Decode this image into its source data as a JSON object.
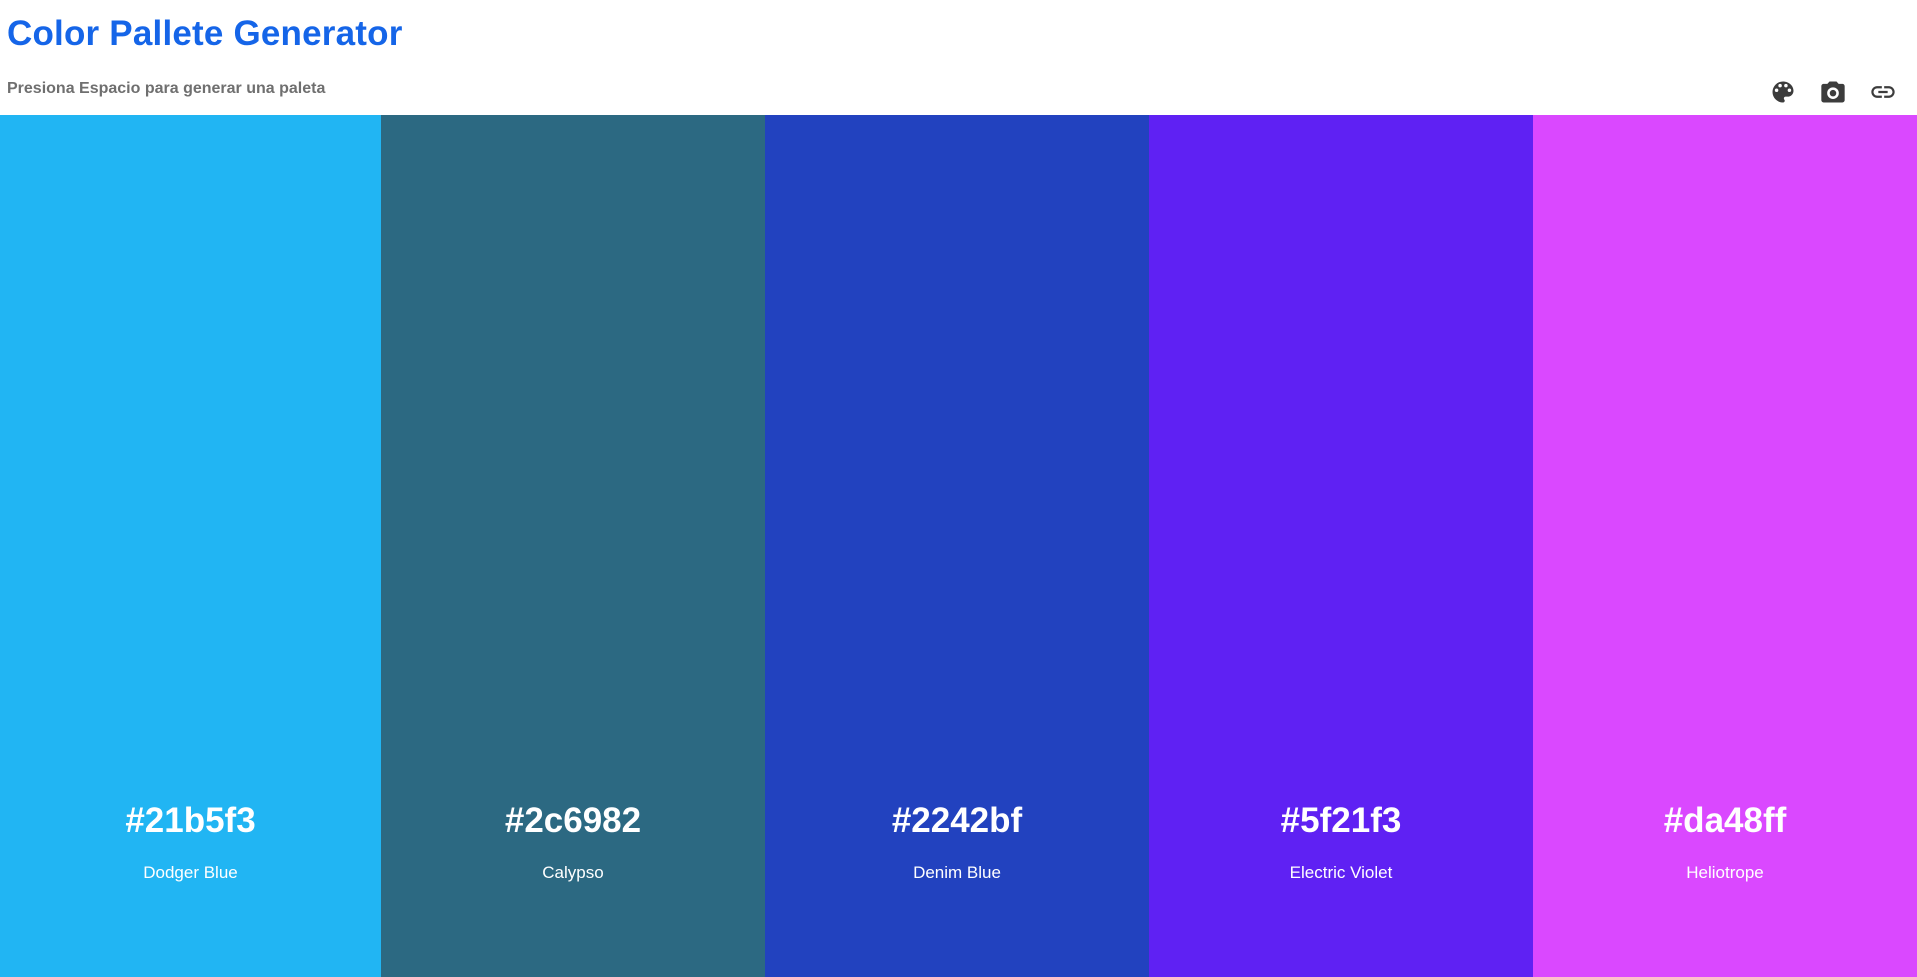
{
  "header": {
    "title": "Color Pallete Generator",
    "subtitle": "Presiona Espacio para generar una paleta"
  },
  "toolbar": {
    "icons": [
      "palette-icon",
      "camera-icon",
      "link-icon"
    ],
    "icon_color": "#3c3c3c"
  },
  "colors": {
    "title": "#1565e8",
    "subtitle": "#6f6f6f"
  },
  "palette": [
    {
      "hex": "#21b5f3",
      "name": "Dodger Blue"
    },
    {
      "hex": "#2c6982",
      "name": "Calypso"
    },
    {
      "hex": "#2242bf",
      "name": "Denim Blue"
    },
    {
      "hex": "#5f21f3",
      "name": "Electric Violet"
    },
    {
      "hex": "#da48ff",
      "name": "Heliotrope"
    }
  ]
}
